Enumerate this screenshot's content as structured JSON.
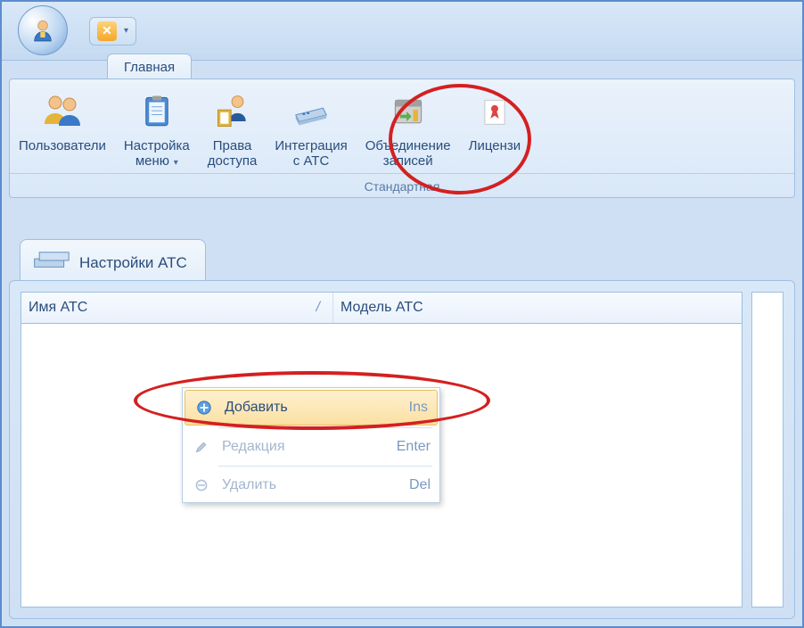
{
  "header": {
    "orb_icon": "user-icon",
    "qat_close_icon": "close-x-icon"
  },
  "tabs": {
    "main": "Главная"
  },
  "ribbon": {
    "users": "Пользователи",
    "menu_setup": "Настройка\nменю",
    "access": "Права\nдоступа",
    "integration": "Интеграция\nс АТС",
    "merge": "Объединение\nзаписей",
    "license": "Лицензи",
    "group": "Стандартная"
  },
  "subtab": {
    "label": "Настройки АТС"
  },
  "columns": {
    "name": "Имя АТС",
    "model": "Модель АТС",
    "sort": "/"
  },
  "context_menu": {
    "add": {
      "label": "Добавить",
      "shortcut": "Ins"
    },
    "edit": {
      "label": "Редакция",
      "shortcut": "Enter"
    },
    "del": {
      "label": "Удалить",
      "shortcut": "Del"
    }
  }
}
